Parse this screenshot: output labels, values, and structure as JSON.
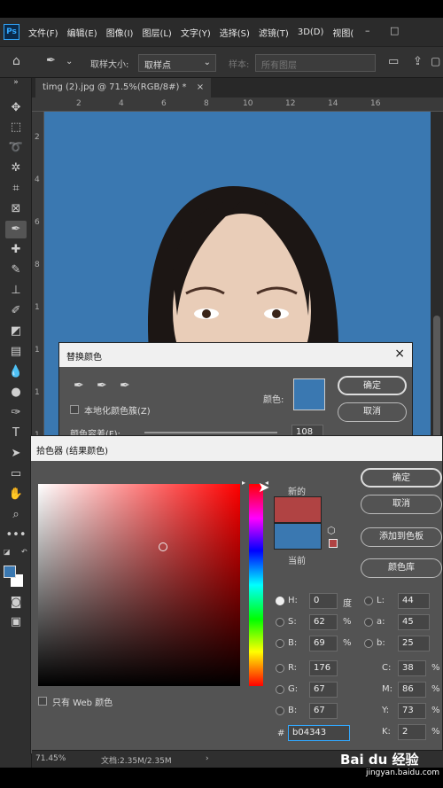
{
  "menubar": {
    "logo": "Ps",
    "items": [
      "文件(F)",
      "编辑(E)",
      "图像(I)",
      "图层(L)",
      "文字(Y)",
      "选择(S)",
      "滤镜(T)",
      "3D(D)",
      "视图("
    ],
    "minimize": "–",
    "maximize": "□"
  },
  "optionsbar": {
    "sample_size_label": "取样大小:",
    "sample_size_value": "取样点",
    "sample_label": "样本:",
    "sample_value": "所有图层"
  },
  "tab": {
    "title": "timg (2).jpg @ 71.5%(RGB/8#) *",
    "close": "×"
  },
  "rulers": {
    "h_ticks": [
      "2",
      "4",
      "6",
      "8",
      "10",
      "12",
      "14",
      "16"
    ],
    "v_ticks": [
      "2",
      "4",
      "6",
      "8",
      "1",
      "1",
      "1",
      "1"
    ]
  },
  "replace_color": {
    "title": "替换颜色",
    "close": "×",
    "localized_label": "本地化颜色簇(Z)",
    "color_label": "颜色:",
    "color_swatch": "#3a78b1",
    "fuzziness_label": "颜色容差(F):",
    "fuzziness_value": "108",
    "ok": "确定",
    "cancel": "取消"
  },
  "color_picker": {
    "title": "拾色器 (结果颜色)",
    "close": "×",
    "new_label": "新的",
    "current_label": "当前",
    "new_color": "#b04343",
    "current_color": "#3a78b1",
    "ok": "确定",
    "cancel": "取消",
    "add_swatch": "添加到色板",
    "color_libraries": "颜色库",
    "web_only": "只有 Web 颜色",
    "hue_fraction": 0.0,
    "saturation_pct": 62,
    "brightness_pct": 69,
    "H": {
      "label": "H:",
      "value": "0",
      "unit": "度"
    },
    "S": {
      "label": "S:",
      "value": "62",
      "unit": "%"
    },
    "B": {
      "label": "B:",
      "value": "69",
      "unit": "%"
    },
    "R": {
      "label": "R:",
      "value": "176"
    },
    "G": {
      "label": "G:",
      "value": "67"
    },
    "Bl": {
      "label": "B:",
      "value": "67"
    },
    "L": {
      "label": "L:",
      "value": "44"
    },
    "a": {
      "label": "a:",
      "value": "45"
    },
    "b": {
      "label": "b:",
      "value": "25"
    },
    "C": {
      "label": "C:",
      "value": "38",
      "unit": "%"
    },
    "M": {
      "label": "M:",
      "value": "86",
      "unit": "%"
    },
    "Y": {
      "label": "Y:",
      "value": "73",
      "unit": "%"
    },
    "K": {
      "label": "K:",
      "value": "2",
      "unit": "%"
    },
    "hex_label": "#",
    "hex_value": "b04343"
  },
  "status": {
    "zoom": "71.45%",
    "doc": "文档:2.35M/2.35M"
  },
  "watermark": {
    "logo": "Bai du 经验",
    "url": "jingyan.baidu.com"
  }
}
